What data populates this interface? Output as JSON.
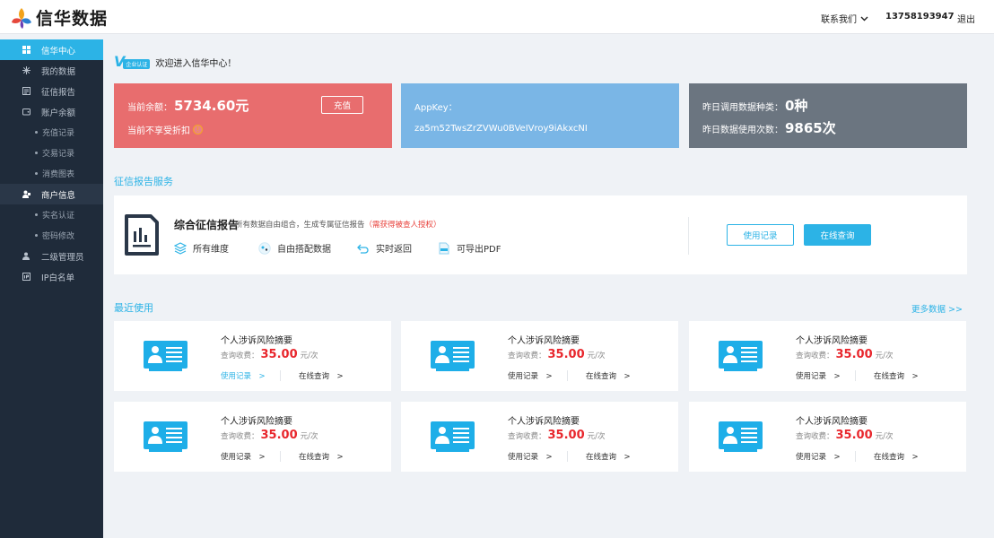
{
  "brand": {
    "name": "信华数据",
    "colors": {
      "accent": "#2cb3e6",
      "sidebar": "#1f2b3a",
      "red_card": "#e86d6e",
      "blue_card": "#7ab6e6",
      "gray_card": "#6b7580",
      "price": "#e8262c"
    }
  },
  "header": {
    "contact_label": "联系我们",
    "phone": "13758193947",
    "logout_label": "退出"
  },
  "sidebar": {
    "items": [
      {
        "label": "信华中心",
        "icon": "dashboard-icon",
        "state": "active"
      },
      {
        "label": "我的数据",
        "icon": "snowflake-icon"
      },
      {
        "label": "征信报告",
        "icon": "report-icon"
      },
      {
        "label": "账户余额",
        "icon": "wallet-icon"
      },
      {
        "label": "充值记录",
        "sub": true
      },
      {
        "label": "交易记录",
        "sub": true
      },
      {
        "label": "消费图表",
        "sub": true
      },
      {
        "label": "商户信息",
        "icon": "merchant-icon",
        "state": "group"
      },
      {
        "label": "实名认证",
        "sub": true
      },
      {
        "label": "密码修改",
        "sub": true
      },
      {
        "label": "二级管理员",
        "icon": "admin-icon"
      },
      {
        "label": "IP白名单",
        "icon": "ip-icon"
      }
    ]
  },
  "welcome": {
    "badge_letter": "V",
    "badge_tag": "企业认证",
    "text": "欢迎进入信华中心！"
  },
  "stats": {
    "balance_label": "当前余额：",
    "balance_value": "5734.60元",
    "recharge_label": "充值",
    "discount_label": "当前不享受折扣",
    "appkey_label": "AppKey：",
    "appkey_value": "za5m52TwsZrZVWu0BVeIVroy9iAkxcNI",
    "types_label": "昨日调用数据种类：",
    "types_value": "0种",
    "usage_label": "昨日数据使用次数：",
    "usage_value": "9865次"
  },
  "service_section": {
    "title": "征信报告服务",
    "product_title": "综合征信报告",
    "product_desc": "所有数据自由组合，生成专属征信报告",
    "product_warn": "（需获得被查人授权）",
    "features": [
      {
        "label": "所有维度",
        "icon": "layers-icon"
      },
      {
        "label": "自由搭配数据",
        "icon": "mix-icon"
      },
      {
        "label": "实时返回",
        "icon": "return-icon"
      },
      {
        "label": "可导出PDF",
        "icon": "pdf-icon"
      }
    ],
    "usage_button": "使用记录",
    "query_button": "在线查询"
  },
  "recent": {
    "title": "最近使用",
    "more_label": "更多数据 >>",
    "cards": [
      {
        "title": "个人涉诉风险摘要",
        "fee_label": "查询收费：",
        "price": "35.00",
        "unit": "元/次",
        "usage": "使用记录　>",
        "query": "在线查询　>",
        "usage_highlight": true
      },
      {
        "title": "个人涉诉风险摘要",
        "fee_label": "查询收费：",
        "price": "35.00",
        "unit": "元/次",
        "usage": "使用记录　>",
        "query": "在线查询　>"
      },
      {
        "title": "个人涉诉风险摘要",
        "fee_label": "查询收费：",
        "price": "35.00",
        "unit": "元/次",
        "usage": "使用记录　>",
        "query": "在线查询　>"
      },
      {
        "title": "个人涉诉风险摘要",
        "fee_label": "查询收费：",
        "price": "35.00",
        "unit": "元/次",
        "usage": "使用记录　>",
        "query": "在线查询　>"
      },
      {
        "title": "个人涉诉风险摘要",
        "fee_label": "查询收费：",
        "price": "35.00",
        "unit": "元/次",
        "usage": "使用记录　>",
        "query": "在线查询　>"
      },
      {
        "title": "个人涉诉风险摘要",
        "fee_label": "查询收费：",
        "price": "35.00",
        "unit": "元/次",
        "usage": "使用记录　>",
        "query": "在线查询　>"
      }
    ]
  }
}
